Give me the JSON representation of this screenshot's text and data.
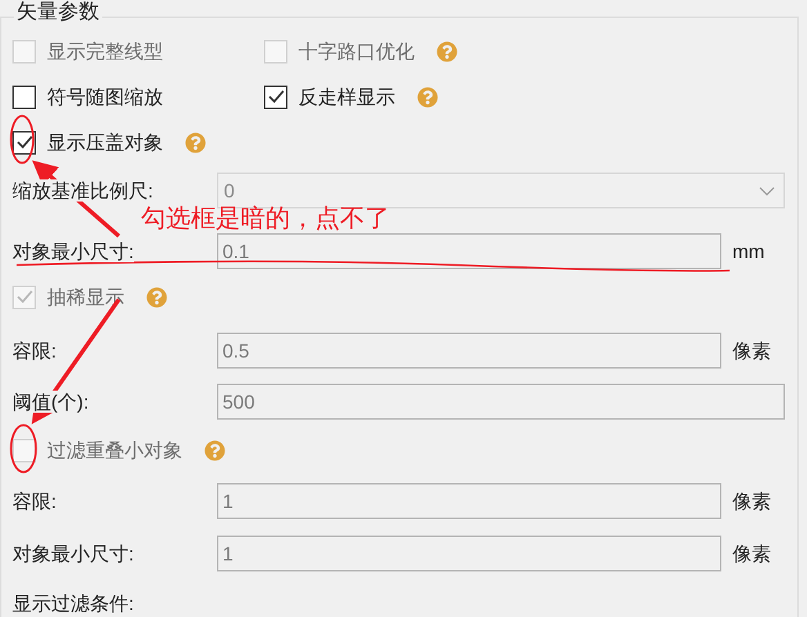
{
  "group": {
    "title": "矢量参数"
  },
  "rows": [
    {
      "kind": "checks",
      "items": [
        {
          "label": "显示完整线型",
          "checked": false,
          "disabled": true,
          "help": false
        },
        {
          "label": "十字路口优化",
          "checked": false,
          "disabled": true,
          "help": true
        }
      ]
    },
    {
      "kind": "checks",
      "items": [
        {
          "label": "符号随图缩放",
          "checked": false,
          "disabled": false,
          "help": false
        },
        {
          "label": "反走样显示",
          "checked": true,
          "disabled": false,
          "help": true
        }
      ]
    },
    {
      "kind": "checks",
      "items": [
        {
          "label": "显示压盖对象",
          "checked": true,
          "disabled": false,
          "help": true
        }
      ]
    },
    {
      "kind": "dropdown",
      "label": "缩放基准比例尺:",
      "value": "0"
    },
    {
      "kind": "field",
      "label": "对象最小尺寸:",
      "value": "0.1",
      "unit": "mm"
    },
    {
      "kind": "checks",
      "items": [
        {
          "label": "抽稀显示",
          "checked": true,
          "disabled": true,
          "help": true
        }
      ]
    },
    {
      "kind": "field",
      "label": "容限:",
      "value": "0.5",
      "unit": "像素"
    },
    {
      "kind": "field",
      "label": "阈值(个):",
      "value": "500"
    },
    {
      "kind": "checks",
      "items": [
        {
          "label": "过滤重叠小对象",
          "checked": false,
          "disabled": true,
          "help": true
        }
      ]
    },
    {
      "kind": "field",
      "label": "容限:",
      "value": "1",
      "unit": "像素"
    },
    {
      "kind": "field",
      "label": "对象最小尺寸:",
      "value": "1",
      "unit": "像素"
    },
    {
      "kind": "label",
      "label": "显示过滤条件:"
    }
  ],
  "annotation": {
    "note": "勾选框是暗的，点不了"
  }
}
